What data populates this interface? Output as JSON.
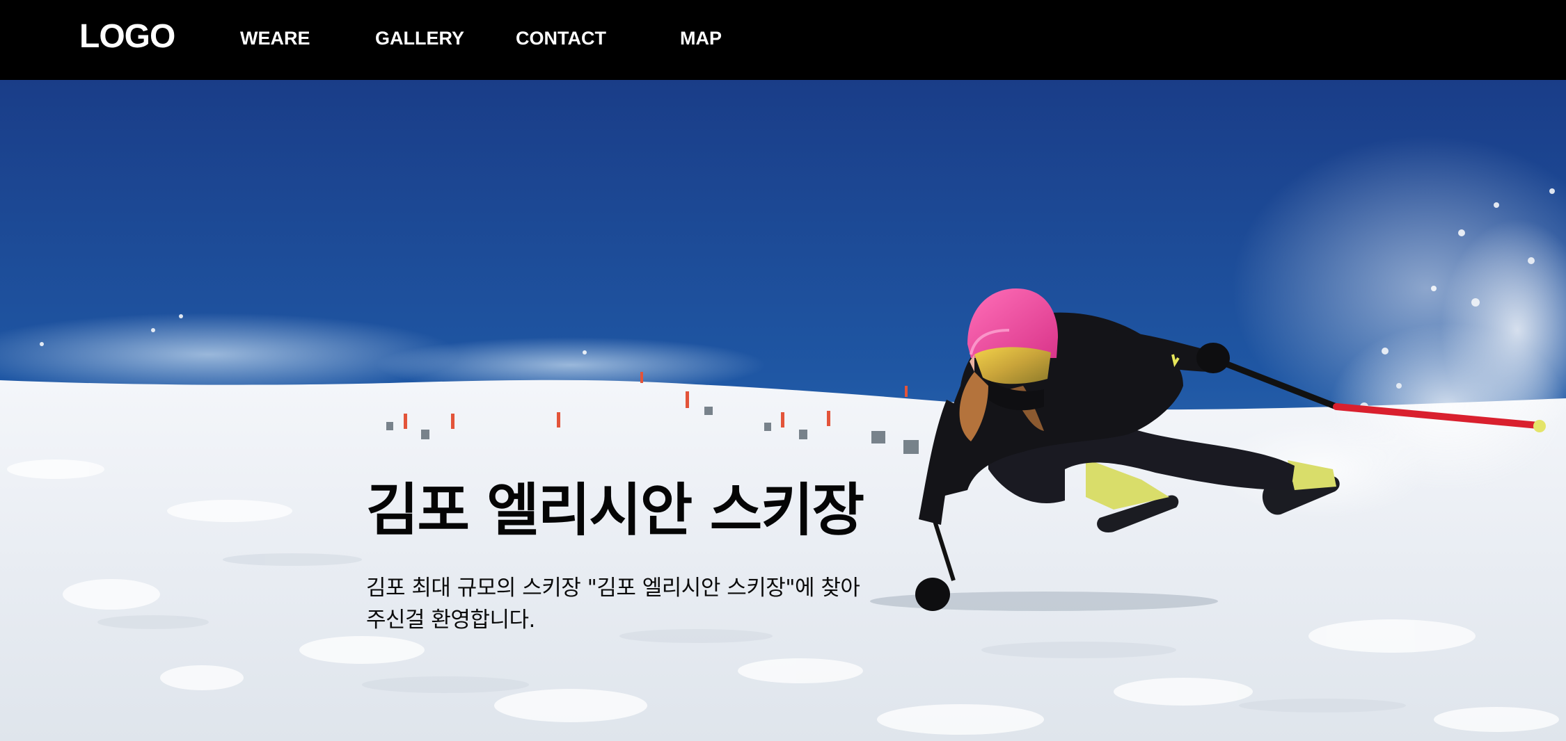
{
  "header": {
    "logo": "LOGO",
    "nav": [
      {
        "label": "WEARE"
      },
      {
        "label": "GALLERY"
      },
      {
        "label": "CONTACT"
      },
      {
        "label": "MAP"
      }
    ]
  },
  "hero": {
    "title": "김포 엘리시안 스키장",
    "description": "김포 최대 규모의 스키장 \"김포 엘리시안 스키장\"에 찾아주신걸 환영합니다."
  },
  "colors": {
    "header_bg": "#000000",
    "sky_top": "#1b3f8a",
    "sky_bottom": "#3f86c6",
    "snow": "#eef2f7",
    "helmet": "#e8479c",
    "jacket": "#141418",
    "pole": "#d9202e"
  }
}
